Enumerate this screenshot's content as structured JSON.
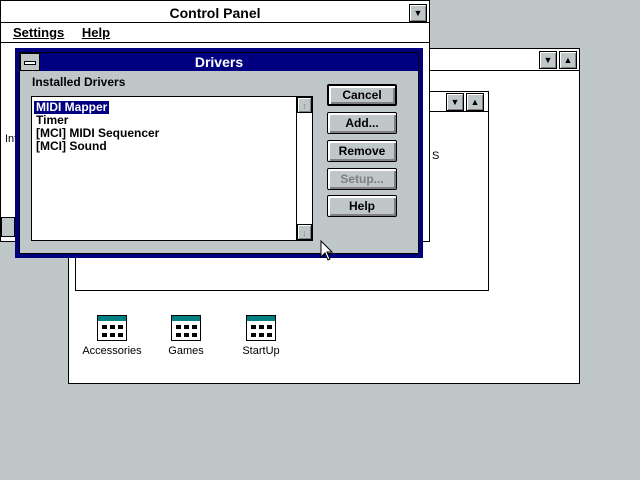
{
  "control_panel": {
    "title": "Control Panel",
    "menu": [
      "Settings",
      "Help"
    ]
  },
  "drivers": {
    "title": "Drivers",
    "label": "Installed Drivers",
    "items": [
      "MIDI Mapper",
      "Timer",
      "[MCI] MIDI Sequencer",
      "[MCI] Sound"
    ],
    "selected_index": 0,
    "buttons": {
      "cancel": "Cancel",
      "add": "Add...",
      "remove": "Remove",
      "setup": "Setup...",
      "help": "Help"
    }
  },
  "program_manager": {
    "groups": [
      "Accessories",
      "Games",
      "StartUp"
    ]
  },
  "partial_text": {
    "left_edge": "Int",
    "right_edge": "S"
  },
  "colors": {
    "desktop": "#c0c7c8",
    "active_caption": "#000080",
    "selection": "#000080"
  }
}
